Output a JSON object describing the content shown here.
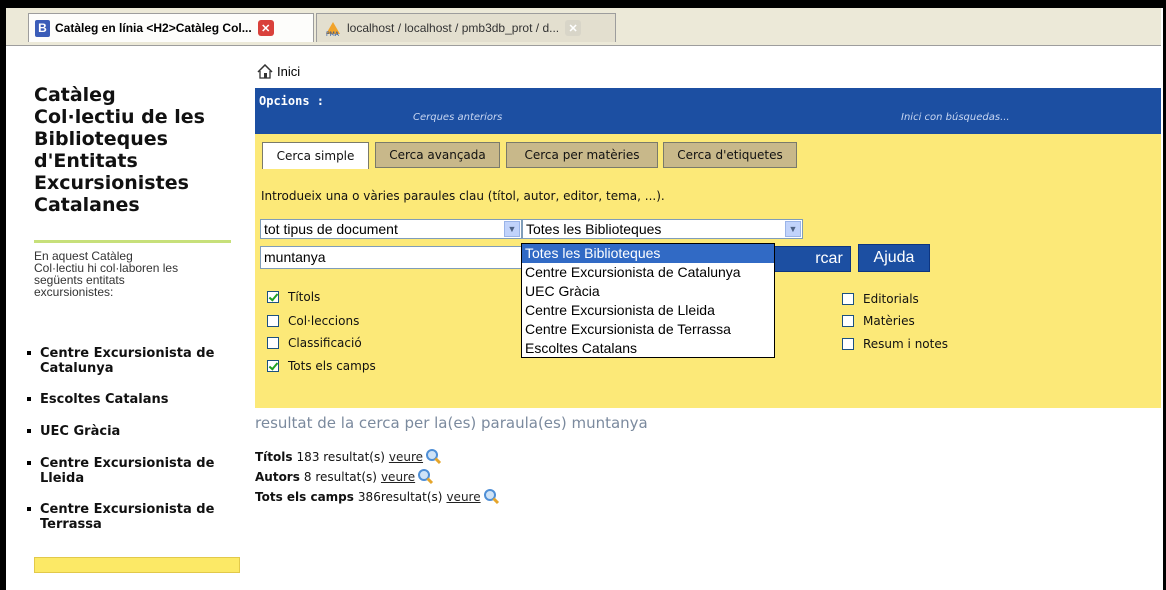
{
  "browser": {
    "tabs": [
      {
        "label": "Catàleg en línia <H2>Catàleg Col...",
        "icon": "catalog-favicon",
        "active": true
      },
      {
        "label": "localhost / localhost / pmb3db_prot / d...",
        "icon": "phpmyadmin-favicon",
        "active": false
      }
    ],
    "favicon_letter": "B"
  },
  "sidebar": {
    "title_lines": [
      "Catàleg",
      "Col·lectiu de les",
      "Biblioteques",
      "d'Entitats",
      "Excursionistes",
      "Catalanes"
    ],
    "intro_lines": [
      "En aquest Catàleg",
      "Col·lectiu hi col·laboren les",
      "següents entitats",
      "excursionistes:"
    ],
    "items": [
      {
        "lines": [
          "Centre Excursionista de",
          "Catalunya"
        ]
      },
      {
        "lines": [
          "Escoltes Catalans"
        ]
      },
      {
        "lines": [
          "UEC Gràcia"
        ]
      },
      {
        "lines": [
          "Centre Excursionista de",
          "Lleida"
        ]
      },
      {
        "lines": [
          "Centre Excursionista de",
          "Terrassa"
        ]
      }
    ]
  },
  "main": {
    "home_link": "Inici",
    "options_label": "Opcions :",
    "previous_searches": "Cerques anteriors",
    "start_with_searches": "Inici con búsquedas...",
    "search_tabs": [
      {
        "label": "Cerca simple",
        "active": true
      },
      {
        "label": "Cerca avançada",
        "active": false
      },
      {
        "label": "Cerca per matèries",
        "active": false
      },
      {
        "label": "Cerca d'etiquetes",
        "active": false
      }
    ],
    "hint": "Introdueix una o vàries paraules clau (títol, autor, editor, tema, ...).",
    "doc_type_select": "tot tipus de document",
    "library_select": "Totes les Biblioteques",
    "library_options": [
      "Totes les Biblioteques",
      "Centre Excursionista de Catalunya",
      "UEC Gràcia",
      "Centre Excursionista de Lleida",
      "Centre Excursionista de Terrassa",
      "Escoltes Catalans"
    ],
    "selected_library_index": 0,
    "search_value": "muntanya",
    "search_button_visible": "rcar",
    "help_button": "Ajuda",
    "checkboxes_left": [
      {
        "label": "Títols",
        "checked": true
      },
      {
        "label": "Col·leccions",
        "checked": false
      },
      {
        "label": "Classificació",
        "checked": false
      },
      {
        "label": "Tots els camps",
        "checked": true
      }
    ],
    "checkboxes_right": [
      {
        "label": "Editorials",
        "checked": false
      },
      {
        "label": "Matèries",
        "checked": false
      },
      {
        "label": "Resum i notes",
        "checked": false
      }
    ],
    "results_heading": "resultat de la cerca per la(es) paraula(es) muntanya",
    "results": [
      {
        "field": "Títols",
        "count": "183 resultat(s)",
        "link": "veure"
      },
      {
        "field": "Autors",
        "count": "8 resultat(s)",
        "link": "veure"
      },
      {
        "field": "Tots els camps",
        "count": "386resultat(s)",
        "link": "veure"
      }
    ]
  },
  "colors": {
    "blue_bar": "#1c4fa2",
    "yellow_panel": "#fce978",
    "dropdown_highlight": "#316ac5"
  }
}
